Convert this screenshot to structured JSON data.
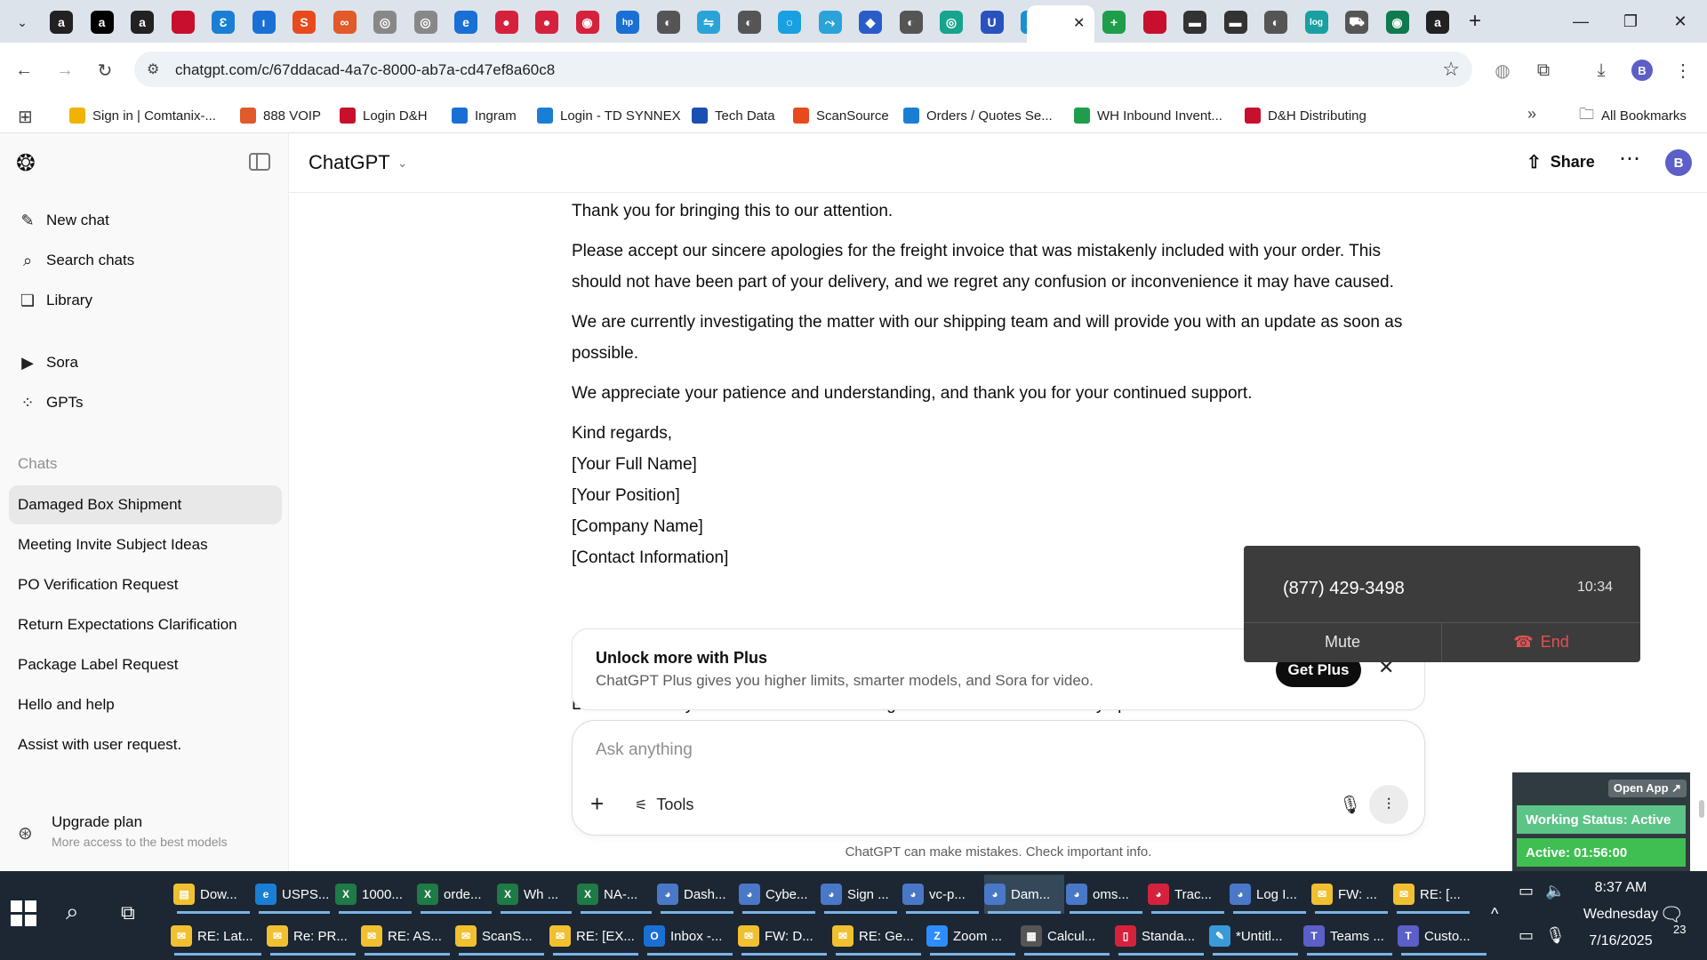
{
  "browser": {
    "url": "chatgpt.com/c/67ddacad-4a7c-8000-ab7a-cd47ef8a60c8",
    "tab_favicons": [
      {
        "name": "amazon-1",
        "color": "#222",
        "glyph": "a"
      },
      {
        "name": "amazon-2",
        "color": "#000",
        "glyph": "a"
      },
      {
        "name": "amazon-3",
        "color": "#222",
        "glyph": "a"
      },
      {
        "name": "dh-1",
        "color": "#c8102e",
        "glyph": ""
      },
      {
        "name": "ec-1",
        "color": "#1a7fd4",
        "glyph": "Ɛ"
      },
      {
        "name": "ingram-1",
        "color": "#1a6fd4",
        "glyph": "ı"
      },
      {
        "name": "scansource-1",
        "color": "#e84a1d",
        "glyph": "S"
      },
      {
        "name": "888-1",
        "color": "#e05a2a",
        "glyph": "∞"
      },
      {
        "name": "globe-1",
        "color": "#888",
        "glyph": "◎"
      },
      {
        "name": "globe-2",
        "color": "#888",
        "glyph": "◎"
      },
      {
        "name": "edge-1",
        "color": "#1a6fd4",
        "glyph": "e"
      },
      {
        "name": "red-1",
        "color": "#d6213d",
        "glyph": "●"
      },
      {
        "name": "red-2",
        "color": "#d6213d",
        "glyph": "●"
      },
      {
        "name": "red-3",
        "color": "#d6213d",
        "glyph": "◉"
      },
      {
        "name": "hp-1",
        "color": "#1a6fd4",
        "glyph": "hp"
      },
      {
        "name": "globe-3",
        "color": "#555",
        "glyph": "◐"
      },
      {
        "name": "blue-1",
        "color": "#2aa4d8",
        "glyph": "⇋"
      },
      {
        "name": "globe-4",
        "color": "#555",
        "glyph": "◐"
      },
      {
        "name": "blue-2",
        "color": "#19a0e0",
        "glyph": "○"
      },
      {
        "name": "blue-3",
        "color": "#2aa4d8",
        "glyph": "⤳"
      },
      {
        "name": "diamond-1",
        "color": "#2a5cc8",
        "glyph": "◆"
      },
      {
        "name": "globe-5",
        "color": "#555",
        "glyph": "◐"
      },
      {
        "name": "green-1",
        "color": "#17a38c",
        "glyph": "◎"
      },
      {
        "name": "u-1",
        "color": "#2a52be",
        "glyph": "U"
      },
      {
        "name": "cloud-1",
        "color": "#1a8fd4",
        "glyph": "☁"
      },
      {
        "name": "sheets-1",
        "color": "#1e9e4a",
        "glyph": "+"
      },
      {
        "name": "dh-2",
        "color": "#c8102e",
        "glyph": ""
      },
      {
        "name": "ebay-1",
        "color": "#333",
        "glyph": "▬"
      },
      {
        "name": "ebay-2",
        "color": "#333",
        "glyph": "▬"
      },
      {
        "name": "globe-6",
        "color": "#555",
        "glyph": "◐"
      },
      {
        "name": "log-1",
        "color": "#19a0a0",
        "glyph": "log"
      },
      {
        "name": "car-1",
        "color": "#555",
        "glyph": "⛟"
      },
      {
        "name": "green-2",
        "color": "#0e7a4e",
        "glyph": "◉"
      },
      {
        "name": "amazon-4",
        "color": "#222",
        "glyph": "a"
      }
    ],
    "bookmarks": [
      {
        "label": "Sign in | Comtanix-...",
        "color": "#f0b400"
      },
      {
        "label": "888 VOIP",
        "color": "#e05a2a"
      },
      {
        "label": "Login D&H",
        "color": "#c8102e"
      },
      {
        "label": "Ingram",
        "color": "#1a6fd4"
      },
      {
        "label": "Login - TD SYNNEX",
        "color": "#1a7fd4"
      },
      {
        "label": "Tech Data",
        "color": "#1a4fb4"
      },
      {
        "label": "ScanSource",
        "color": "#e84a1d"
      },
      {
        "label": "Orders / Quotes Se...",
        "color": "#1a7fd4"
      },
      {
        "label": "WH Inbound Invent...",
        "color": "#1e9e4a"
      },
      {
        "label": "D&H Distributing",
        "color": "#c8102e"
      }
    ],
    "all_bookmarks_label": "All Bookmarks",
    "profile_initial": "B"
  },
  "sidebar": {
    "nav": [
      {
        "label": "New chat",
        "icon": "✎"
      },
      {
        "label": "Search chats",
        "icon": "⌕"
      },
      {
        "label": "Library",
        "icon": "❏"
      }
    ],
    "nav2": [
      {
        "label": "Sora",
        "icon": "▶"
      },
      {
        "label": "GPTs",
        "icon": "⁘"
      }
    ],
    "chats_heading": "Chats",
    "chats": [
      "Damaged Box Shipment",
      "Meeting Invite Subject Ideas",
      "PO Verification Request",
      "Return Expectations Clarification",
      "Package Label Request",
      "Hello and help",
      "Assist with user request."
    ],
    "upgrade_title": "Upgrade plan",
    "upgrade_sub": "More access to the best models"
  },
  "main": {
    "model_name": "ChatGPT",
    "share_label": "Share",
    "avatar_initial": "B",
    "message": {
      "p1": "Thank you for bringing this to our attention.",
      "p2": "Please accept our sincere apologies for the freight invoice that was mistakenly included with your order. This should not have been part of your delivery, and we regret any confusion or inconvenience it may have caused.",
      "p3": "We are currently investigating the matter with our shipping team and will provide you with an update as soon as possible.",
      "p4": "We appreciate your patience and understanding, and thank you for your continued support.",
      "signature": [
        "Kind regards,",
        "[Your Full Name]",
        "[Your Position]",
        "[Company Name]",
        "[Contact Information]"
      ]
    },
    "trailing_text": "Let me know if you'd like to soften or strengthen the tone or include any specific reference numbers.",
    "upsell": {
      "title": "Unlock more with Plus",
      "desc": "ChatGPT Plus gives you higher limits, smarter models, and Sora for video.",
      "button": "Get Plus"
    },
    "composer": {
      "placeholder": "Ask anything",
      "tools_label": "Tools"
    },
    "disclaimer": "ChatGPT can make mistakes. Check important info."
  },
  "call": {
    "number": "(877) 429-3498",
    "timer": "10:34",
    "mute_label": "Mute",
    "end_label": "End"
  },
  "status_widget": {
    "open_app": "Open App ↗",
    "working_status": "Working Status: Active",
    "active_time": "Active: 01:56:00"
  },
  "taskbar": {
    "row1": [
      {
        "label": "Dow...",
        "color": "#f0c030",
        "glyph": "▤"
      },
      {
        "label": "USPS...",
        "color": "#1a7fd4",
        "glyph": "e"
      },
      {
        "label": "1000...",
        "color": "#1e7a46",
        "glyph": "X"
      },
      {
        "label": "orde...",
        "color": "#1e7a46",
        "glyph": "X"
      },
      {
        "label": "Wh ...",
        "color": "#1e7a46",
        "glyph": "X"
      },
      {
        "label": "NA-...",
        "color": "#1e7a46",
        "glyph": "X"
      },
      {
        "label": "Dash...",
        "color": "#4a78c8",
        "glyph": "◕"
      },
      {
        "label": "Cybe...",
        "color": "#4a78c8",
        "glyph": "◕"
      },
      {
        "label": "Sign ...",
        "color": "#4a78c8",
        "glyph": "◕"
      },
      {
        "label": "vc-p...",
        "color": "#4a78c8",
        "glyph": "◕"
      },
      {
        "label": "Dam...",
        "color": "#4a78c8",
        "glyph": "◕"
      },
      {
        "label": "oms...",
        "color": "#4a78c8",
        "glyph": "◕"
      },
      {
        "label": "Trac...",
        "color": "#d6213d",
        "glyph": "◕"
      },
      {
        "label": "Log I...",
        "color": "#4a78c8",
        "glyph": "◕"
      },
      {
        "label": "FW: ...",
        "color": "#f0c030",
        "glyph": "✉"
      },
      {
        "label": "RE: [...",
        "color": "#f0c030",
        "glyph": "✉"
      }
    ],
    "row2": [
      {
        "label": "RE: Lat...",
        "color": "#f0c030",
        "glyph": "✉"
      },
      {
        "label": "Re: PR...",
        "color": "#f0c030",
        "glyph": "✉"
      },
      {
        "label": "RE: AS...",
        "color": "#f0c030",
        "glyph": "✉"
      },
      {
        "label": "ScanS...",
        "color": "#f0c030",
        "glyph": "✉"
      },
      {
        "label": "RE: [EX...",
        "color": "#f0c030",
        "glyph": "✉"
      },
      {
        "label": "Inbox -...",
        "color": "#1a6fd4",
        "glyph": "O"
      },
      {
        "label": "FW: D...",
        "color": "#f0c030",
        "glyph": "✉"
      },
      {
        "label": "RE: Ge...",
        "color": "#f0c030",
        "glyph": "✉"
      },
      {
        "label": "Zoom ...",
        "color": "#2d8cff",
        "glyph": "Z"
      },
      {
        "label": "Calcul...",
        "color": "#555",
        "glyph": "▦"
      },
      {
        "label": "Standa...",
        "color": "#d6213d",
        "glyph": "▯"
      },
      {
        "label": "*Untitl...",
        "color": "#3a9ad9",
        "glyph": "✎"
      },
      {
        "label": "Teams ...",
        "color": "#5b5fc7",
        "glyph": "T"
      },
      {
        "label": "Custo...",
        "color": "#5b5fc7",
        "glyph": "T"
      }
    ],
    "clock_time": "8:37 AM",
    "clock_day": "Wednesday",
    "clock_date": "7/16/2025",
    "notification_count": "23"
  }
}
